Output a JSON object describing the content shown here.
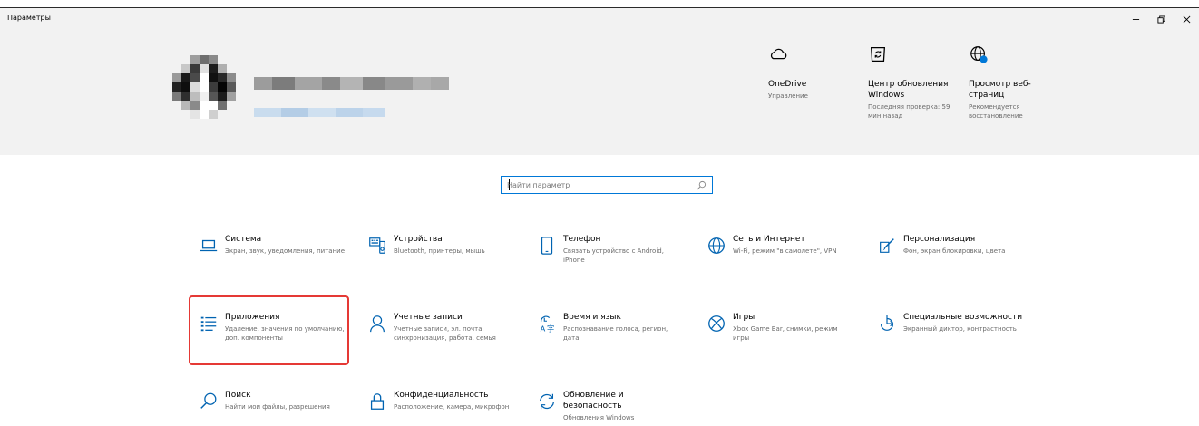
{
  "window": {
    "title": "Параметры"
  },
  "header": {
    "quick_links": [
      {
        "icon": "cloud-icon",
        "title": "OneDrive",
        "subtitle": "Управление"
      },
      {
        "icon": "sync-icon",
        "title": "Центр обновления Windows",
        "subtitle": "Последняя проверка: 59 мин назад"
      },
      {
        "icon": "globe-icon",
        "title": "Просмотр веб-страниц",
        "subtitle": "Рекомендуется восстановление"
      }
    ]
  },
  "search": {
    "placeholder": "Найти параметр",
    "value": ""
  },
  "categories": [
    {
      "icon": "laptop-icon",
      "title": "Система",
      "subtitle": "Экран, звук, уведомления, питание"
    },
    {
      "icon": "keyboard-icon",
      "title": "Устройства",
      "subtitle": "Bluetooth, принтеры, мышь"
    },
    {
      "icon": "phone-icon",
      "title": "Телефон",
      "subtitle": "Связать устройство с Android, iPhone"
    },
    {
      "icon": "globe-icon",
      "title": "Сеть и Интернет",
      "subtitle": "Wi-Fi, режим \"в самолете\", VPN"
    },
    {
      "icon": "paint-icon",
      "title": "Персонализация",
      "subtitle": "Фон, экран блокировки, цвета"
    },
    {
      "icon": "apps-list-icon",
      "title": "Приложения",
      "subtitle": "Удаление, значения по умолчанию, доп. компоненты"
    },
    {
      "icon": "person-icon",
      "title": "Учетные записи",
      "subtitle": "Учетные записи, эл. почта, синхронизация, работа, семья"
    },
    {
      "icon": "time-language-icon",
      "title": "Время и язык",
      "subtitle": "Распознавание голоса, регион, дата"
    },
    {
      "icon": "xbox-icon",
      "title": "Игры",
      "subtitle": "Xbox Game Bar, снимки, режим игры"
    },
    {
      "icon": "accessibility-icon",
      "title": "Специальные возможности",
      "subtitle": "Экранный диктор, контрастность"
    },
    {
      "icon": "search-icon",
      "title": "Поиск",
      "subtitle": "Найти мои файлы, разрешения"
    },
    {
      "icon": "lock-icon",
      "title": "Конфиденциальность",
      "subtitle": "Расположение, камера, микрофон"
    },
    {
      "icon": "update-icon",
      "title": "Обновление и безопасность",
      "subtitle": "Обновления Windows"
    }
  ],
  "colors": {
    "accent": "#0078d7",
    "header_bg": "#f2f2f2",
    "highlight": "#e53935"
  }
}
